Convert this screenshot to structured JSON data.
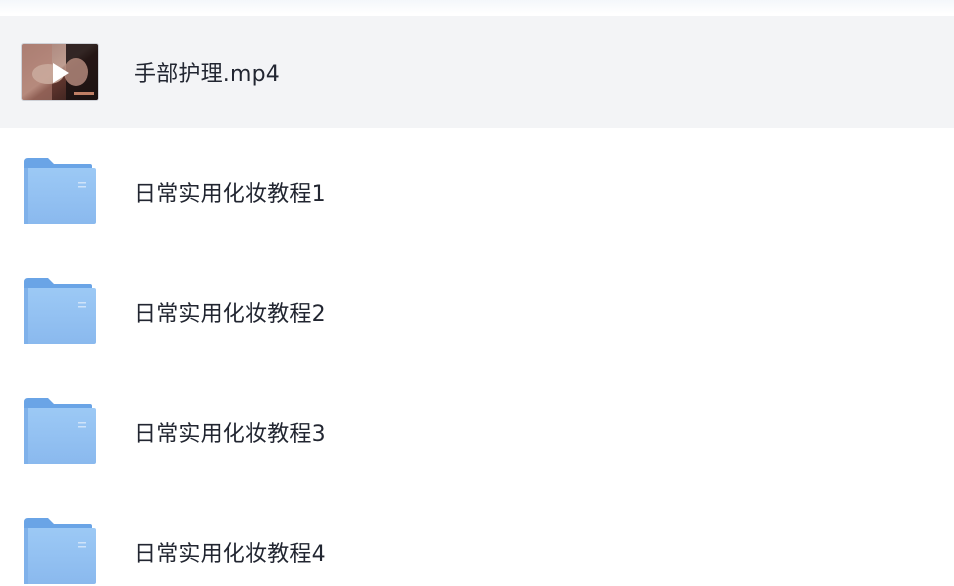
{
  "files": [
    {
      "name": "手部护理.mp4",
      "type": "video",
      "selected": true
    },
    {
      "name": "日常实用化妆教程1",
      "type": "folder",
      "selected": false
    },
    {
      "name": "日常实用化妆教程2",
      "type": "folder",
      "selected": false
    },
    {
      "name": "日常实用化妆教程3",
      "type": "folder",
      "selected": false
    },
    {
      "name": "日常实用化妆教程4",
      "type": "folder",
      "selected": false
    }
  ],
  "icons": {
    "video": "video-thumbnail-play-icon",
    "folder": "folder-icon"
  },
  "colors": {
    "selected_row_bg": "#f3f4f6",
    "folder_blue": "#8cc0f4",
    "text": "#222631"
  }
}
